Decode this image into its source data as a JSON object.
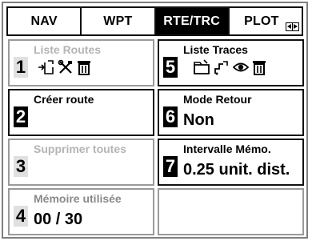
{
  "tabs": [
    {
      "label": "NAV",
      "active": false
    },
    {
      "label": "WPT",
      "active": false
    },
    {
      "label": "RTE/TRC",
      "active": true
    },
    {
      "label": "PLOT",
      "active": false
    }
  ],
  "cells": {
    "c1": {
      "number": "1",
      "label": "Liste Routes",
      "enabled": false,
      "icons": [
        "edit-route-icon",
        "tools-icon",
        "trash-icon"
      ]
    },
    "c2": {
      "number": "2",
      "label": "Créer route",
      "enabled": true
    },
    "c3": {
      "number": "3",
      "label": "Supprimer toutes",
      "enabled": false
    },
    "c4": {
      "number": "4",
      "label": "Mémoire utilisée",
      "value": "00 / 30",
      "enabled": true
    },
    "c5": {
      "number": "5",
      "label": "Liste Traces",
      "enabled": true,
      "icons": [
        "folder-icon",
        "track-edit-icon",
        "eye-icon",
        "trash-icon"
      ]
    },
    "c6": {
      "number": "6",
      "label": "Mode Retour",
      "value": "Non",
      "enabled": true
    },
    "c7": {
      "number": "7",
      "label": "Intervalle Mémo.",
      "value": "0.25 unit. dist.",
      "enabled": true
    }
  },
  "colors": {
    "active_tab_bg": "#000000",
    "disabled_text": "#b4b4b4",
    "border": "#111111"
  }
}
